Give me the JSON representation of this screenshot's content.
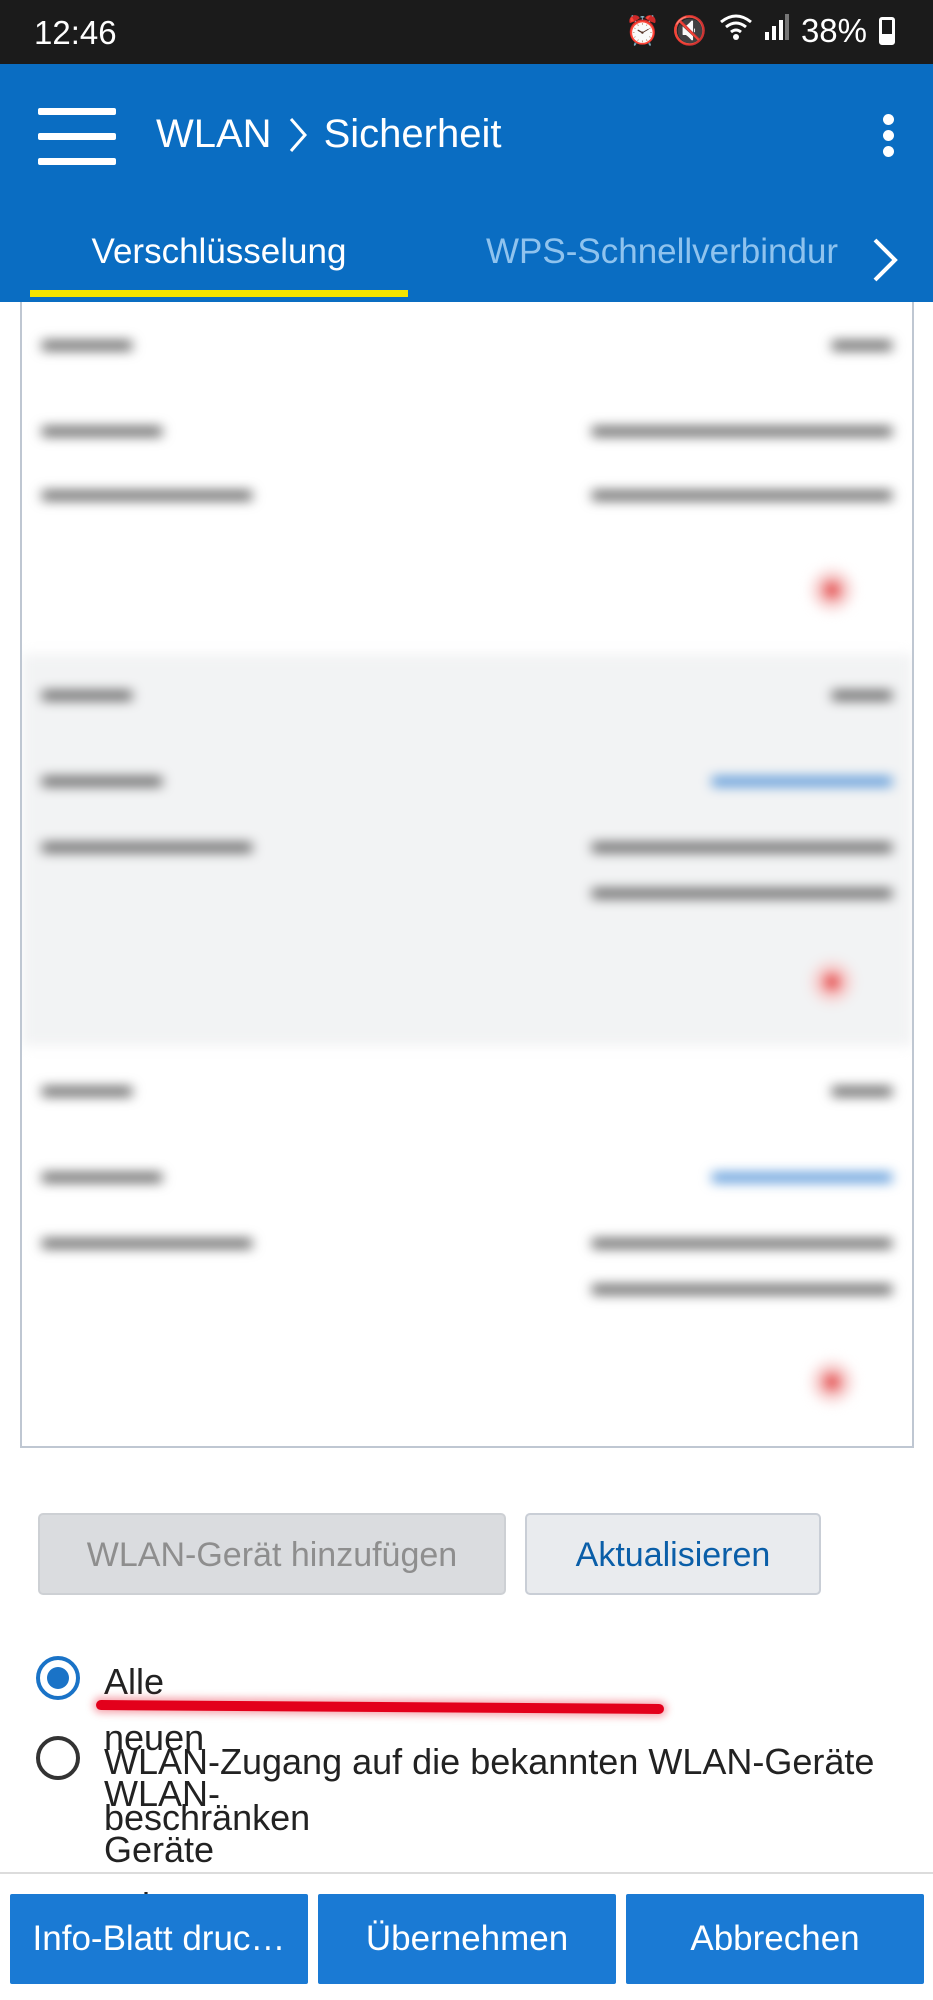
{
  "status_bar": {
    "time": "12:46",
    "battery": "38%",
    "battery_level": 0.38,
    "icons": [
      "alarm-icon",
      "mute-icon",
      "wifi-icon",
      "signal-icon",
      "battery-icon"
    ]
  },
  "app_bar": {
    "breadcrumb": [
      "WLAN",
      "Sicherheit"
    ],
    "color": "#0a6dc2"
  },
  "tabs": [
    {
      "label": "Verschlüsselung",
      "active": true
    },
    {
      "label": "WPS-Schnellverbindur",
      "active": false
    }
  ],
  "buttons": {
    "add_device": "WLAN-Gerät hinzufügen",
    "refresh": "Aktualisieren"
  },
  "radio_options": [
    {
      "label": "Alle neuen WLAN-Geräte zulassen",
      "selected": true
    },
    {
      "label": "WLAN-Zugang auf die bekannten WLAN-Geräte beschränken",
      "selected": false
    }
  ],
  "footer": {
    "info_sheet": "Info-Blatt druc…",
    "apply": "Übernehmen",
    "cancel": "Abbrechen",
    "color": "#1a7ad4"
  }
}
